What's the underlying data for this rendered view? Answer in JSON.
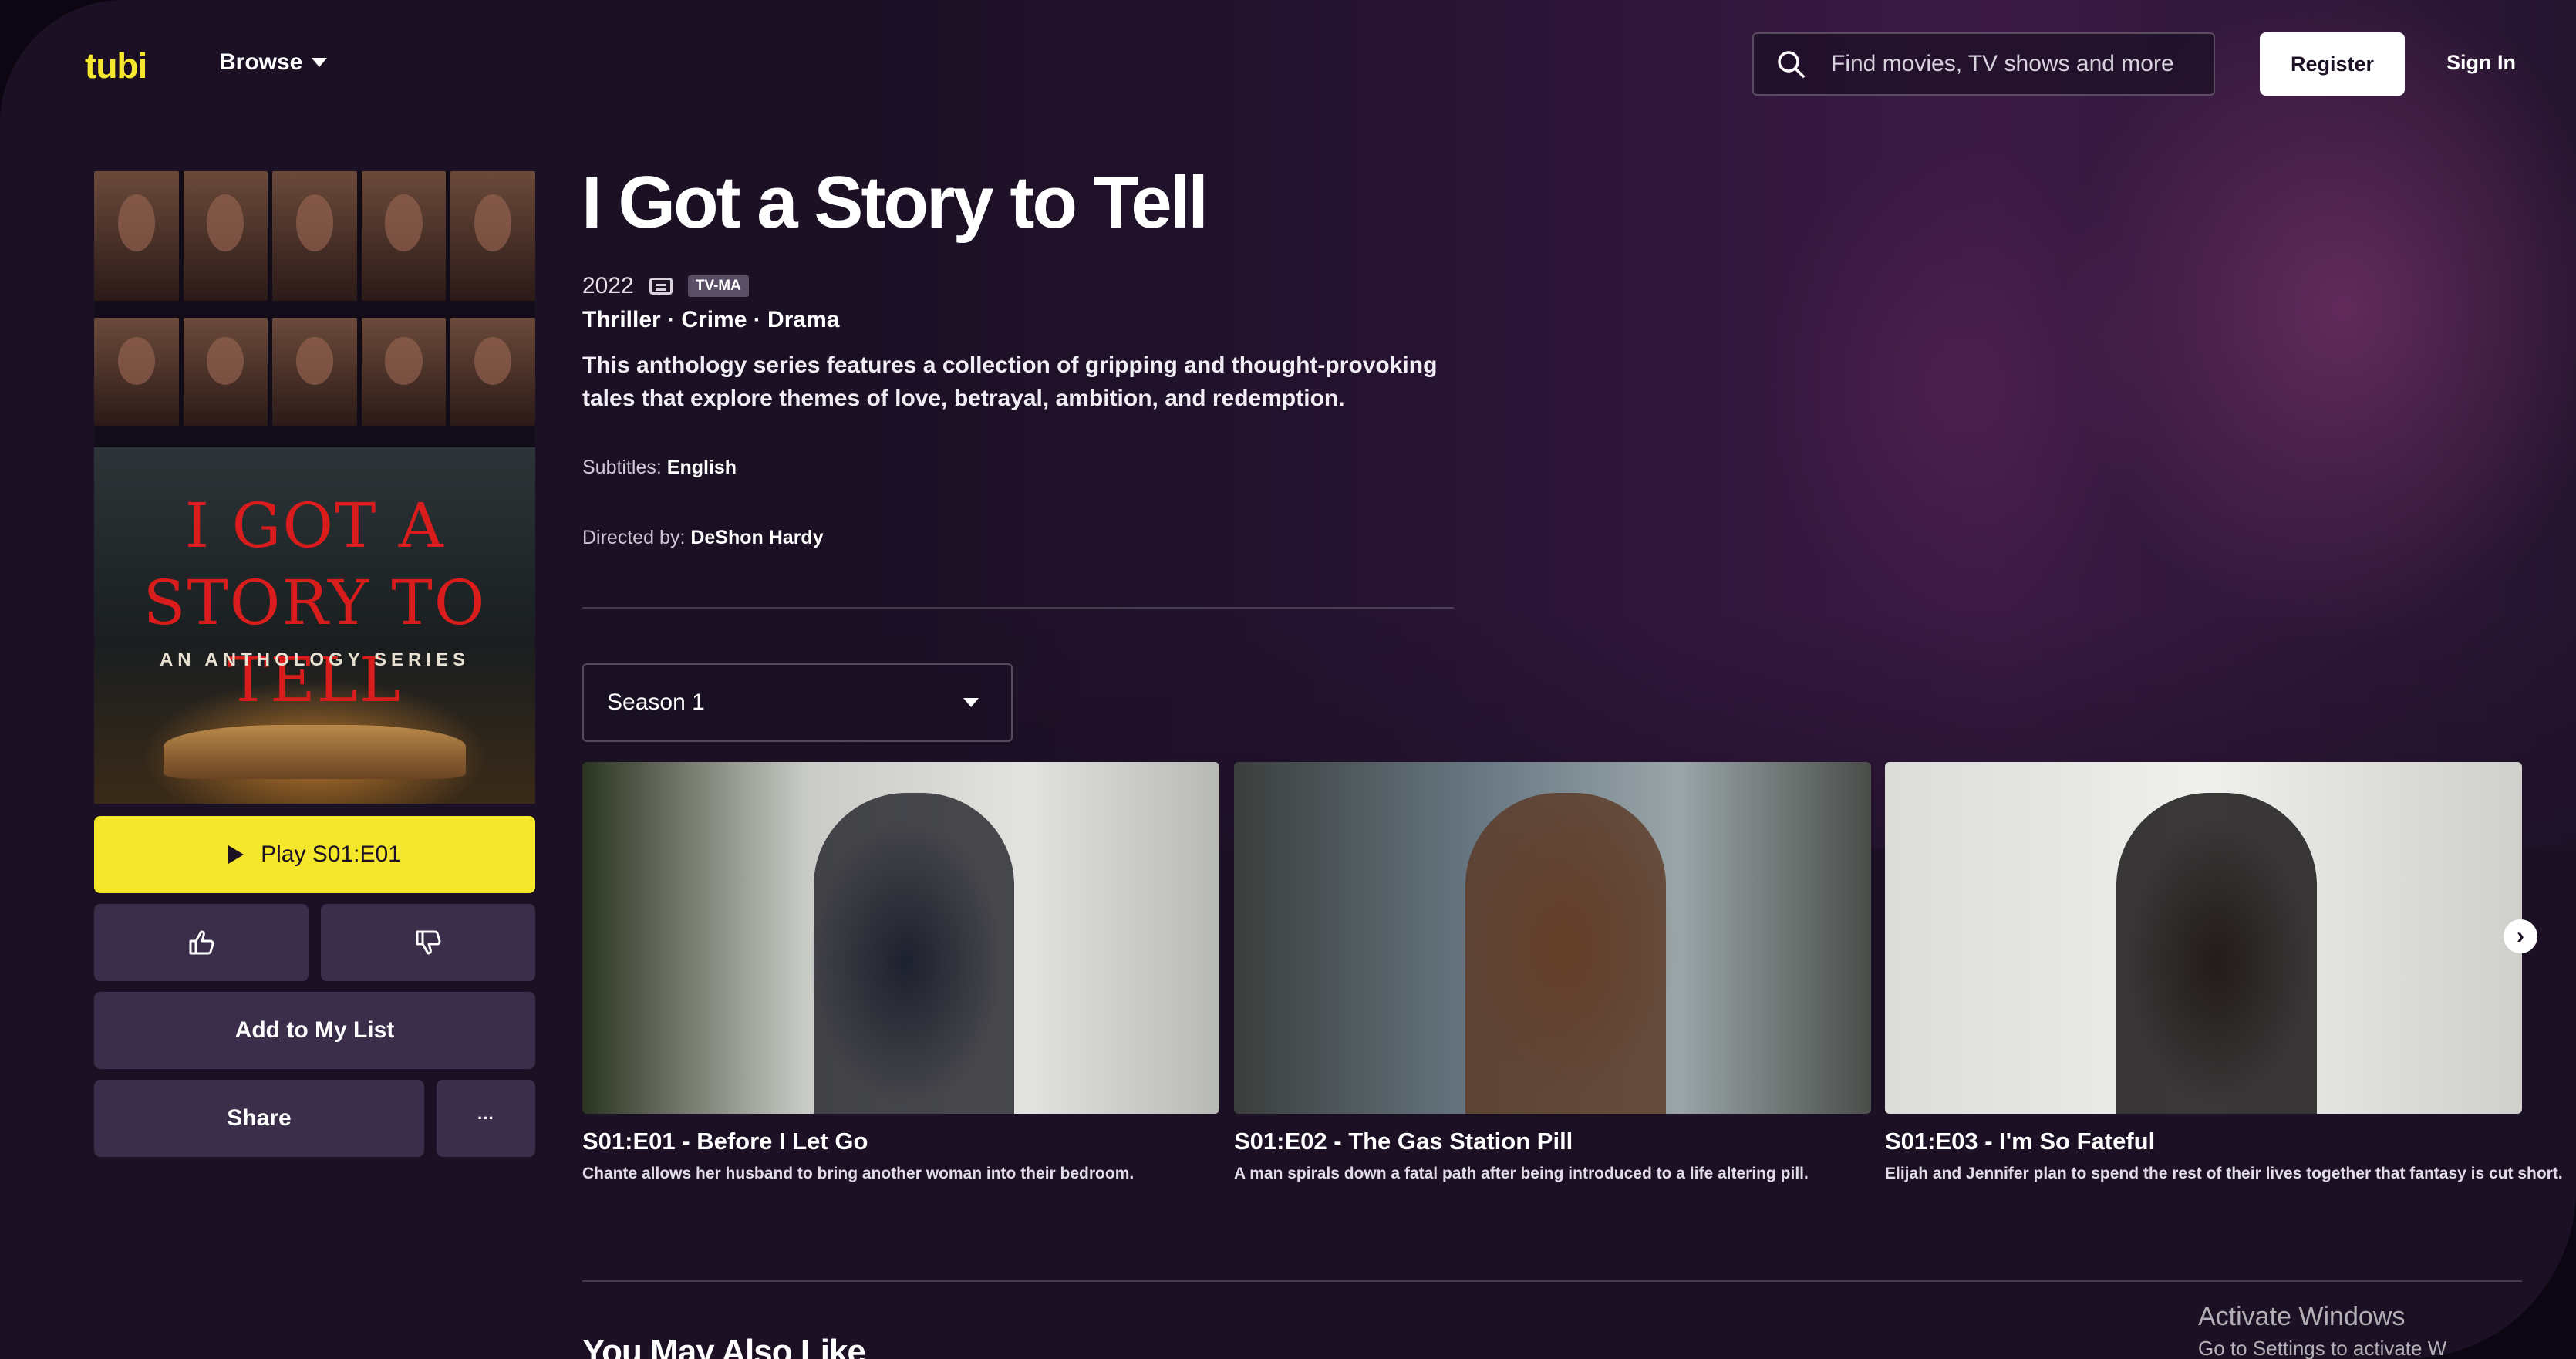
{
  "header": {
    "logo": "tubi",
    "browse_label": "Browse",
    "search_placeholder": "Find movies, TV shows and more",
    "register_label": "Register",
    "signin_label": "Sign In"
  },
  "poster": {
    "title": "I GOT A STORY TO TELL",
    "subtitle": "AN ANTHOLOGY SERIES"
  },
  "actions": {
    "play_label": "Play S01:E01",
    "add_to_list_label": "Add to My List",
    "share_label": "Share",
    "more_label": "···"
  },
  "show": {
    "title": "I Got a Story to Tell",
    "year": "2022",
    "rating": "TV-MA",
    "genres": "Thriller · Crime · Drama",
    "description": "This anthology series features a collection of gripping and thought-provoking tales that explore themes of love, betrayal, ambition, and redemption.",
    "subtitles_label": "Subtitles:",
    "subtitles_value": "English",
    "directed_label": "Directed by:",
    "directed_value": "DeShon Hardy"
  },
  "season_selector": {
    "selected": "Season 1"
  },
  "episodes": [
    {
      "title": "S01:E01 - Before I Let Go",
      "description": "Chante allows her husband to bring another woman into their bedroom."
    },
    {
      "title": "S01:E02 - The Gas Station Pill",
      "description": "A man spirals down a fatal path after being introduced to a life altering pill."
    },
    {
      "title": "S01:E03 - I'm So Fateful",
      "description": "Elijah and Jennifer plan to spend the rest of their lives together that fantasy is cut short."
    }
  ],
  "sections": {
    "you_may_also_like": "You May Also Like"
  },
  "watermark": {
    "line1": "Activate Windows",
    "line2": "Go to Settings to activate W"
  },
  "colors": {
    "accent": "#f5e72c",
    "background": "#1b1024",
    "button_dark": "#3a2e4a"
  }
}
